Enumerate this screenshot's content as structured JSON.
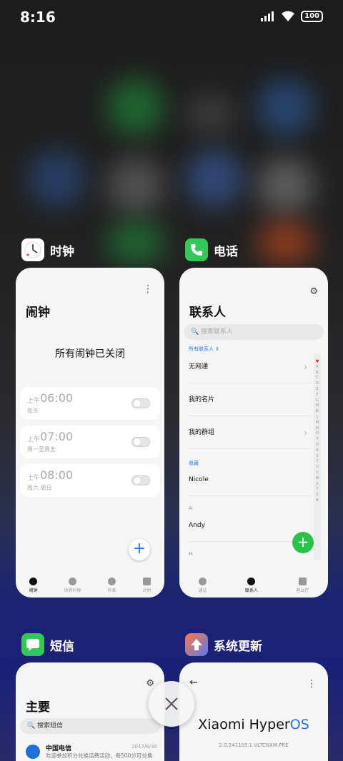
{
  "status_bar": {
    "time": "8:16",
    "battery": "100"
  },
  "apps": {
    "clock": {
      "name": "时钟",
      "title": "闹钟",
      "all_off": "所有闹钟已关闭",
      "alarms": [
        {
          "ampm": "上午",
          "time": "06:00",
          "repeat": "每天"
        },
        {
          "ampm": "上午",
          "time": "07:00",
          "repeat": "周一至周五"
        },
        {
          "ampm": "上午",
          "time": "08:00",
          "repeat": "周六 周日"
        }
      ],
      "tabs": [
        "闹钟",
        "世界时钟",
        "秒表",
        "计时"
      ]
    },
    "phone": {
      "name": "电话",
      "title": "联系人",
      "search_placeholder": "搜索联系人",
      "all_contacts": "所有联系人 ⇕",
      "rows": [
        "无网通",
        "我的名片",
        "我的群组"
      ],
      "fav_section": "收藏",
      "fav_contact": "Nicole",
      "section_a": "A",
      "contact_a": "Andy",
      "section_h": "H",
      "alphabet": "ABCDEFGHIJKLMNOPQRSTUVWXYZ#",
      "tabs": [
        "通话",
        "联系人",
        "营业厅"
      ]
    },
    "sms": {
      "name": "短信",
      "title": "主要",
      "search_placeholder": "搜索短信",
      "message": {
        "sender": "中国电信",
        "date": "2017/6/30",
        "preview": "欢迎参加积分兑换话费活动，每500分可兑换"
      }
    },
    "update": {
      "name": "系统更新",
      "brand": "Xiaomi Hyper",
      "brand_os": "OS",
      "version": "2.0.241105.1.VLTCNXM.PRE"
    }
  },
  "colors": {
    "accent_blue": "#2a7af2",
    "green_fab": "#2cc04c",
    "phone_green": "#34c759"
  }
}
